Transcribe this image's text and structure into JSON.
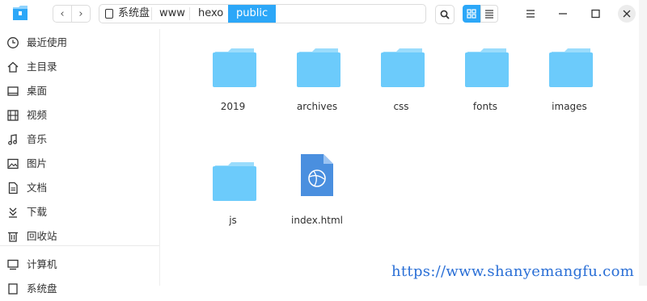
{
  "toolbar": {
    "back_glyph": "‹",
    "forward_glyph": "›"
  },
  "breadcrumb": {
    "items": [
      {
        "label": "系统盘"
      },
      {
        "label": "www"
      },
      {
        "label": "hexo"
      },
      {
        "label": "public"
      }
    ]
  },
  "sidebar": {
    "items": [
      {
        "label": "最近使用",
        "icon": "clock-icon"
      },
      {
        "label": "主目录",
        "icon": "home-icon"
      },
      {
        "label": "桌面",
        "icon": "desktop-icon"
      },
      {
        "label": "视频",
        "icon": "video-icon"
      },
      {
        "label": "音乐",
        "icon": "music-icon"
      },
      {
        "label": "图片",
        "icon": "picture-icon"
      },
      {
        "label": "文档",
        "icon": "document-icon"
      },
      {
        "label": "下载",
        "icon": "download-icon"
      },
      {
        "label": "回收站",
        "icon": "trash-icon"
      },
      {
        "label": "计算机",
        "icon": "computer-icon"
      },
      {
        "label": "系统盘",
        "icon": "disk-icon"
      }
    ]
  },
  "files": [
    {
      "name": "2019",
      "type": "folder"
    },
    {
      "name": "archives",
      "type": "folder"
    },
    {
      "name": "css",
      "type": "folder"
    },
    {
      "name": "fonts",
      "type": "folder"
    },
    {
      "name": "images",
      "type": "folder"
    },
    {
      "name": "js",
      "type": "folder"
    },
    {
      "name": "index.html",
      "type": "html-file"
    }
  ],
  "watermark": "https://www.shanyemangfu.com",
  "colors": {
    "accent": "#2ca7f8",
    "folder": "#6ccbfb",
    "folder_tab": "#9adcfc",
    "html_file": "#4a8fdf"
  }
}
